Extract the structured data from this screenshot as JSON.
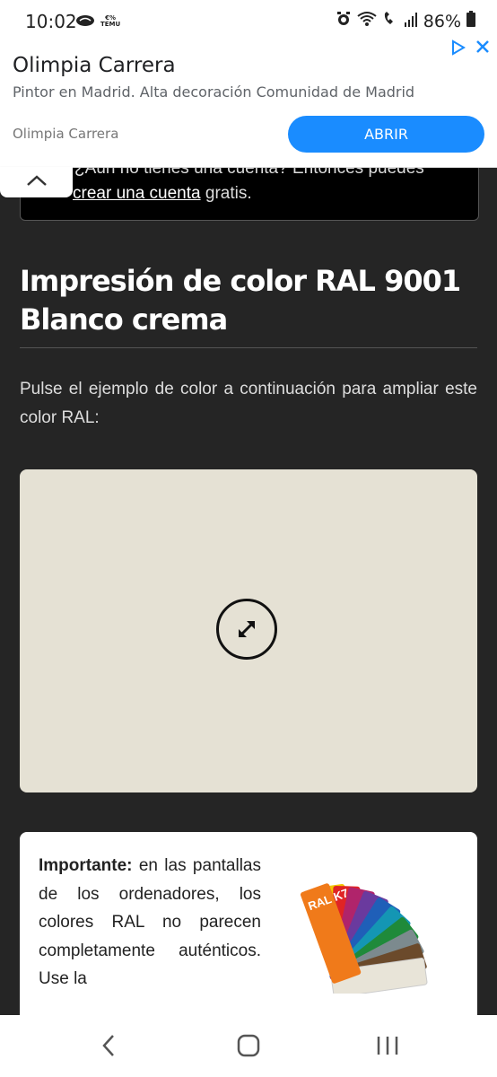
{
  "status_bar": {
    "time": "10:02",
    "battery": "86%",
    "temu_label": "€%\nTEMU"
  },
  "ad": {
    "title": "Olimpia Carrera",
    "description": "Pintor en Madrid. Alta decoración Comunidad de Madrid",
    "advertiser": "Olimpia Carrera",
    "cta": "ABRIR"
  },
  "login_box": {
    "line1": "¿Aún no tienes una cuenta? Entonces puedes",
    "link": "crear una cuenta",
    "line2_rest": " gratis."
  },
  "page": {
    "title": "Impresión de color RAL 9001 Blanco crema",
    "intro": "Pulse el ejemplo de color a continuación para ampliar este color RAL:",
    "swatch_color": "#E5E1D4"
  },
  "notice": {
    "bold": "Importante:",
    "text": " en las pantallas de los ordenadores, los colores RAL no parecen completamente auténticos. Use la",
    "fan_label": "RAL K7"
  },
  "icons": {
    "adchoices": "adchoices-icon",
    "close": "close-icon",
    "expand": "expand-icon",
    "back": "back-icon",
    "home": "home-icon",
    "recents": "recents-icon"
  }
}
